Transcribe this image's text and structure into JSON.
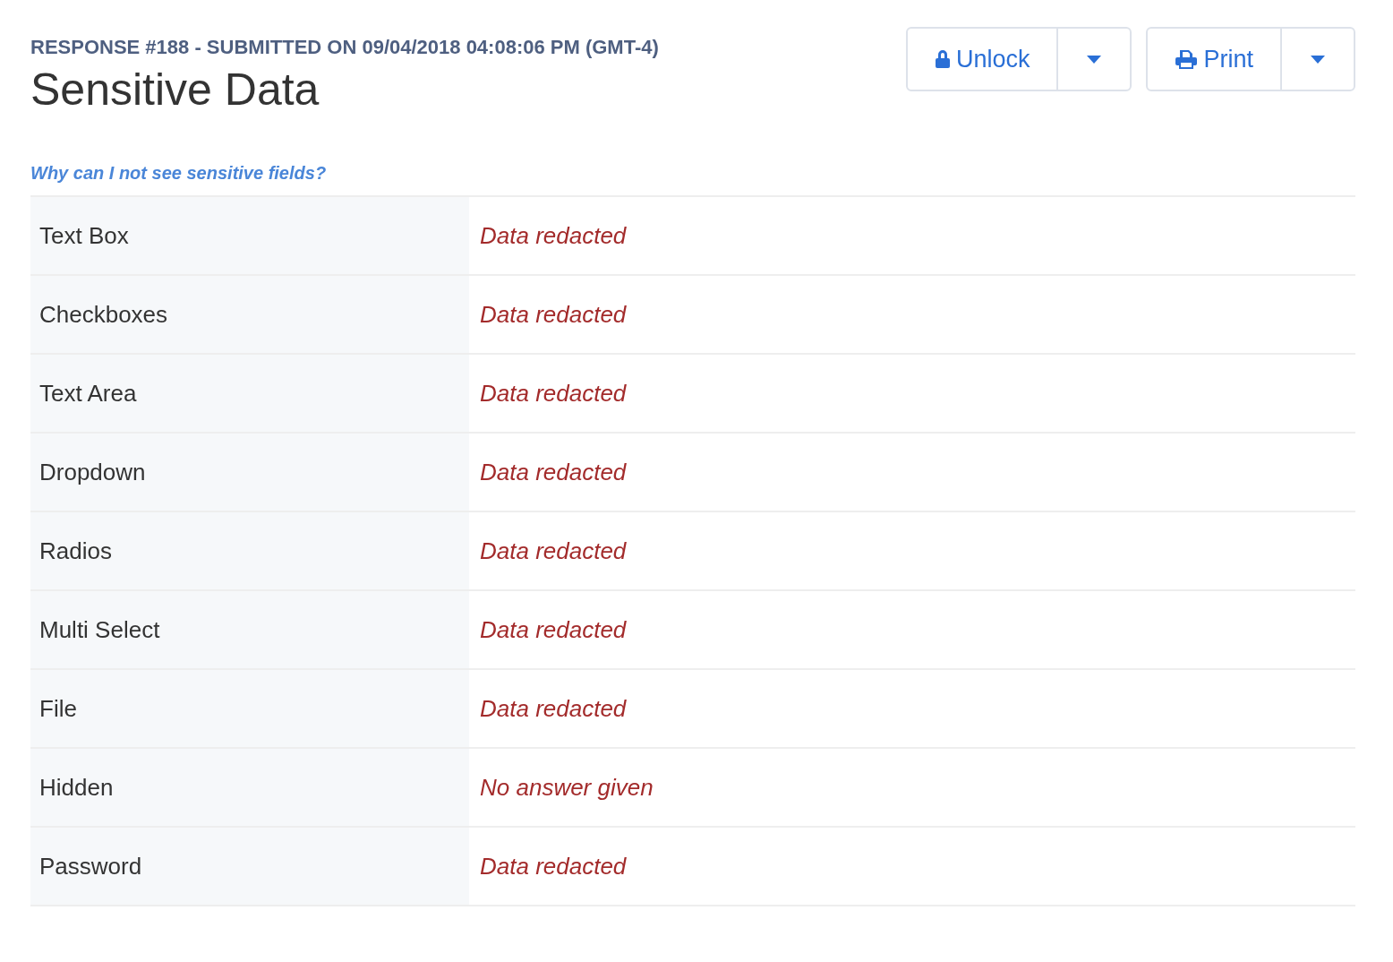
{
  "header": {
    "subtitle": "RESPONSE #188 - SUBMITTED ON 09/04/2018 04:08:06 PM (GMT-4)",
    "title": "Sensitive Data"
  },
  "actions": [
    {
      "label": "Unlock"
    },
    {
      "label": "Print"
    }
  ],
  "help_link": "Why can I not see sensitive fields?",
  "fields": [
    {
      "label": "Text Box",
      "value": "Data redacted"
    },
    {
      "label": "Checkboxes",
      "value": "Data redacted"
    },
    {
      "label": "Text Area",
      "value": "Data redacted"
    },
    {
      "label": "Dropdown",
      "value": "Data redacted"
    },
    {
      "label": "Radios",
      "value": "Data redacted"
    },
    {
      "label": "Multi Select",
      "value": "Data redacted"
    },
    {
      "label": "File",
      "value": "Data redacted"
    },
    {
      "label": "Hidden",
      "value": "No answer given"
    },
    {
      "label": "Password",
      "value": "Data redacted"
    }
  ]
}
